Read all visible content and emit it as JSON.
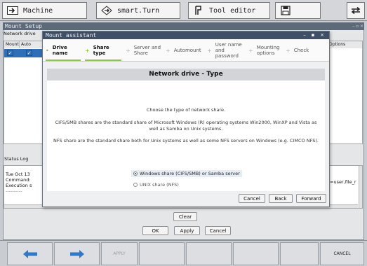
{
  "topbar": {
    "tabs": [
      {
        "label": "Machine",
        "icon": "machine-arrow-icon"
      },
      {
        "label": "smart.Turn",
        "icon": "smart-turn-icon"
      },
      {
        "label": "Tool editor",
        "icon": "tool-editor-icon"
      },
      {
        "label": "",
        "icon": "floppy-disk-icon"
      },
      {
        "label": "",
        "icon": "swap-arrows-icon"
      }
    ]
  },
  "mount_setup": {
    "title": "Mount Setup",
    "network_drive_label": "Network drive",
    "columns": [
      "Mount",
      "Auto"
    ],
    "options_label": "Options",
    "status_log_label": "Status Log",
    "log_lines": [
      "Tue Oct 13",
      "Command:",
      "Execution s",
      "----------"
    ],
    "log_right_fragment": "=user,file_r",
    "clear_label": "Clear",
    "ok_label": "OK",
    "apply_label": "Apply",
    "cancel_label": "Cancel"
  },
  "assistant": {
    "title": "Mount assistant",
    "steps": [
      {
        "label": "Drive\nname",
        "active": true
      },
      {
        "label": "Share\ntype",
        "active": true
      },
      {
        "label": "Server and\nShare",
        "active": false
      },
      {
        "label": "Automount",
        "active": false
      },
      {
        "label": "User name\nand\npassword",
        "active": false
      },
      {
        "label": "Mounting\noptions",
        "active": false
      },
      {
        "label": "Check",
        "active": false
      }
    ],
    "section_title": "Network drive - Type",
    "intro": "Choose the type of network share.",
    "cifs_text": "CIFS/SMB shares are the standard share of Microsoft Windows (R) operating systems Win2000, WinXP and Vista as well as Samba on Unix systems.",
    "nfs_text": "NFS share are the standard share both for Unix systems as well as some NFS servers on Windows (e.g. CIMCO NFS).",
    "options": [
      {
        "label": "Windows share (CIFS/SMB) or Samba server",
        "selected": true
      },
      {
        "label": "UNIX share (NFS)",
        "selected": false
      }
    ],
    "buttons": {
      "cancel": "Cancel",
      "back": "Back",
      "forward": "Forward"
    }
  },
  "softkeys": {
    "back_icon": "arrow-left-icon",
    "forward_icon": "arrow-right-icon",
    "apply": "APPLY",
    "cancel": "CANCEL"
  },
  "colors": {
    "accent_green": "#8dc63f",
    "dialog_title_bg": "#3f4f67",
    "arrow_blue": "#2f79c8"
  }
}
